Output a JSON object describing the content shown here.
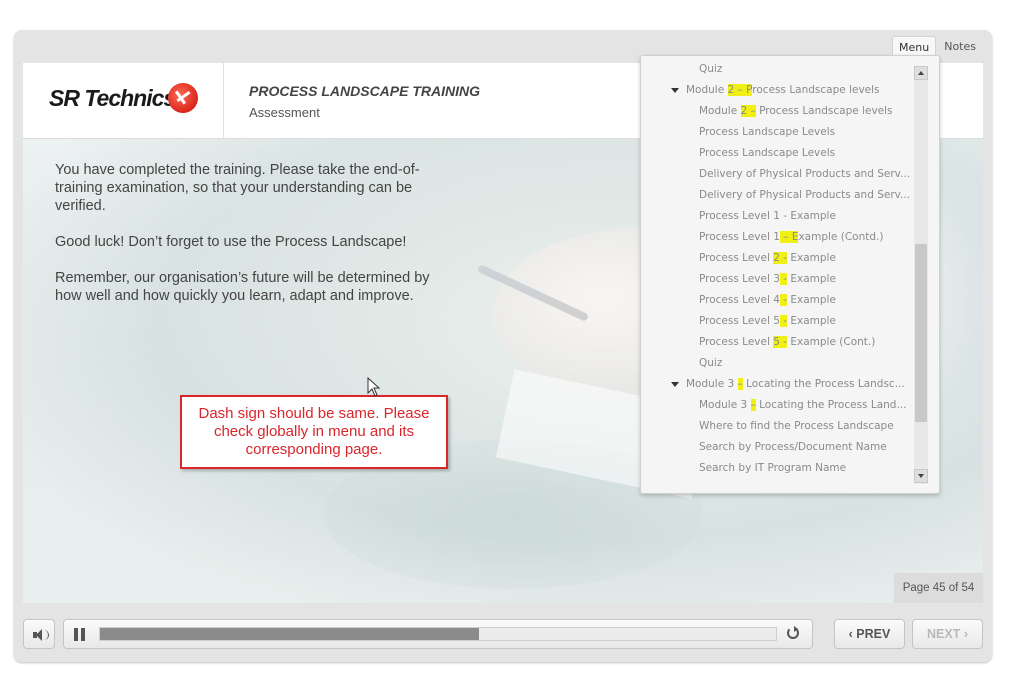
{
  "tabs": {
    "menu": "Menu",
    "notes": "Notes"
  },
  "header": {
    "logo": "SR Technics",
    "course_title": "PROCESS LANDSCAPE TRAINING",
    "section": "Assessment"
  },
  "content": {
    "paragraphs": [
      "You have completed the training. Please take the end-of-training examination, so that your understanding can be verified.",
      "Good luck! Don’t forget to use the Process Landscape!",
      "Remember, our organisation’s future will be determined by how well and how quickly you learn, adapt and improve."
    ],
    "callout": "Dash sign should be same. Please check globally in menu and its corresponding page."
  },
  "menu": {
    "items": [
      {
        "level": 2,
        "parts": [
          "Quiz"
        ]
      },
      {
        "level": 1,
        "parts": [
          "Module ",
          "2 – P",
          "rocess Landscape levels"
        ]
      },
      {
        "level": 2,
        "parts": [
          "Module ",
          "2 –",
          " Process Landscape levels"
        ]
      },
      {
        "level": 2,
        "parts": [
          "Process Landscape Levels"
        ]
      },
      {
        "level": 2,
        "parts": [
          "Process Landscape Levels"
        ]
      },
      {
        "level": 2,
        "parts": [
          "Delivery of Physical Products and Serv..."
        ]
      },
      {
        "level": 2,
        "parts": [
          "Delivery of Physical Products and Serv..."
        ]
      },
      {
        "level": 2,
        "parts": [
          "Process Level 1 - Example"
        ]
      },
      {
        "level": 2,
        "parts": [
          "Process Level 1",
          " – E",
          "xample (Contd.)"
        ]
      },
      {
        "level": 2,
        "parts": [
          "Process Level ",
          "2 -",
          " Example"
        ]
      },
      {
        "level": 2,
        "parts": [
          "Process Level 3",
          " -",
          " Example"
        ]
      },
      {
        "level": 2,
        "parts": [
          "Process Level 4",
          " -",
          " Example"
        ]
      },
      {
        "level": 2,
        "parts": [
          "Process Level 5",
          " -",
          " Example"
        ]
      },
      {
        "level": 2,
        "parts": [
          "Process Level ",
          "5 -",
          " Example (Cont.)"
        ]
      },
      {
        "level": 2,
        "parts": [
          "Quiz"
        ]
      },
      {
        "level": 1,
        "parts": [
          "Module 3 ",
          "–",
          " Locating the Process Landsc..."
        ]
      },
      {
        "level": 2,
        "parts": [
          "Module 3 ",
          "–",
          " Locating the Process Land..."
        ]
      },
      {
        "level": 2,
        "parts": [
          "Where to find the Process Landscape"
        ]
      },
      {
        "level": 2,
        "parts": [
          "Search by Process/Document Name"
        ]
      },
      {
        "level": 2,
        "parts": [
          "Search by IT Program Name"
        ]
      }
    ]
  },
  "page_counter": "Page 45 of 54",
  "controls": {
    "prev": "PREV",
    "next": "NEXT",
    "progress_fraction": 0.56
  },
  "icons": {
    "volume": "speaker-icon",
    "pause": "pause-icon",
    "replay": "reload-icon",
    "prev": "chevron-left-icon",
    "next": "chevron-right-icon",
    "collapse": "caret-down-icon"
  },
  "colors": {
    "callout": "#d9262b",
    "highlight": "#f0f014",
    "progress": "#8b8b8b"
  }
}
